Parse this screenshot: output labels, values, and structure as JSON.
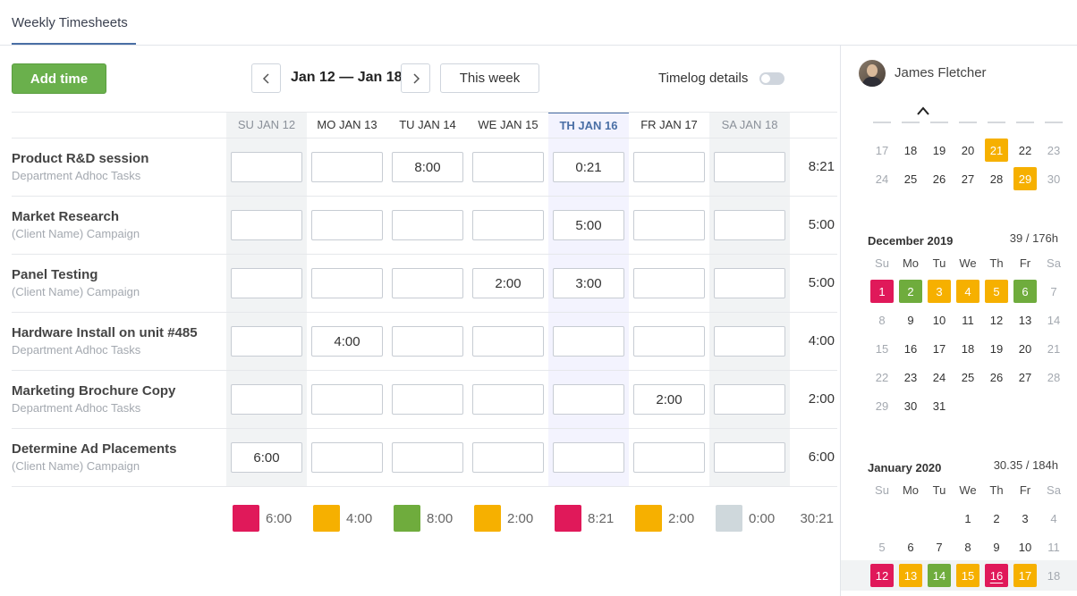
{
  "header": {
    "tab_title": "Weekly Timesheets"
  },
  "toolbar": {
    "add_time": "Add time",
    "date_range": "Jan 12 — Jan 18",
    "this_week": "This week",
    "timelog_details": "Timelog details"
  },
  "days": [
    {
      "label": "SU JAN 12",
      "kind": "weekend"
    },
    {
      "label": "MO JAN 13",
      "kind": "weekday"
    },
    {
      "label": "TU JAN 14",
      "kind": "weekday"
    },
    {
      "label": "WE JAN 15",
      "kind": "weekday"
    },
    {
      "label": "TH JAN 16",
      "kind": "today"
    },
    {
      "label": "FR JAN 17",
      "kind": "weekday"
    },
    {
      "label": "SA JAN 18",
      "kind": "weekend"
    }
  ],
  "rows": [
    {
      "title": "Product R&D session",
      "sub": "Department Adhoc Tasks",
      "cells": [
        "",
        "",
        "8:00",
        "",
        "0:21",
        "",
        ""
      ],
      "total": "8:21"
    },
    {
      "title": "Market Research",
      "sub": "(Client Name) Campaign",
      "cells": [
        "",
        "",
        "",
        "",
        "5:00",
        "",
        ""
      ],
      "total": "5:00"
    },
    {
      "title": "Panel Testing",
      "sub": "(Client Name) Campaign",
      "cells": [
        "",
        "",
        "",
        "2:00",
        "3:00",
        "",
        ""
      ],
      "total": "5:00"
    },
    {
      "title": "Hardware Install on unit #485",
      "sub": "Department Adhoc Tasks",
      "cells": [
        "",
        "4:00",
        "",
        "",
        "",
        "",
        ""
      ],
      "total": "4:00"
    },
    {
      "title": "Marketing Brochure Copy",
      "sub": "Department Adhoc Tasks",
      "cells": [
        "",
        "",
        "",
        "",
        "",
        "2:00",
        ""
      ],
      "total": "2:00"
    },
    {
      "title": "Determine Ad Placements",
      "sub": "(Client Name) Campaign",
      "cells": [
        "6:00",
        "",
        "",
        "",
        "",
        "",
        ""
      ],
      "total": "6:00"
    }
  ],
  "day_totals": [
    {
      "value": "6:00",
      "color": "#e0195a"
    },
    {
      "value": "4:00",
      "color": "#f6b000"
    },
    {
      "value": "8:00",
      "color": "#6fac3d"
    },
    {
      "value": "2:00",
      "color": "#f6b000"
    },
    {
      "value": "8:21",
      "color": "#e0195a"
    },
    {
      "value": "2:00",
      "color": "#f6b000"
    },
    {
      "value": "0:00",
      "color": "#cfd8dc"
    }
  ],
  "grand_total": "30:21",
  "user": {
    "name": "James Fletcher"
  },
  "calendar": {
    "dow": [
      "Su",
      "Mo",
      "Tu",
      "We",
      "Th",
      "Fr",
      "Sa"
    ],
    "prev_tail": [
      [
        {
          "d": "17"
        },
        {
          "d": "18"
        },
        {
          "d": "19"
        },
        {
          "d": "20"
        },
        {
          "d": "21",
          "c": "orange"
        },
        {
          "d": "22"
        },
        {
          "d": "23"
        }
      ],
      [
        {
          "d": "24"
        },
        {
          "d": "25"
        },
        {
          "d": "26"
        },
        {
          "d": "27"
        },
        {
          "d": "28"
        },
        {
          "d": "29",
          "c": "orange"
        },
        {
          "d": "30"
        }
      ]
    ],
    "months": [
      {
        "name": "December 2019",
        "hours": "39 / 176h",
        "weeks": [
          [
            {
              "d": "1",
              "c": "red"
            },
            {
              "d": "2",
              "c": "green"
            },
            {
              "d": "3",
              "c": "orange"
            },
            {
              "d": "4",
              "c": "orange"
            },
            {
              "d": "5",
              "c": "orange"
            },
            {
              "d": "6",
              "c": "green"
            },
            {
              "d": "7"
            }
          ],
          [
            {
              "d": "8"
            },
            {
              "d": "9"
            },
            {
              "d": "10"
            },
            {
              "d": "11"
            },
            {
              "d": "12"
            },
            {
              "d": "13"
            },
            {
              "d": "14"
            }
          ],
          [
            {
              "d": "15"
            },
            {
              "d": "16"
            },
            {
              "d": "17"
            },
            {
              "d": "18"
            },
            {
              "d": "19"
            },
            {
              "d": "20"
            },
            {
              "d": "21"
            }
          ],
          [
            {
              "d": "22"
            },
            {
              "d": "23"
            },
            {
              "d": "24"
            },
            {
              "d": "25"
            },
            {
              "d": "26"
            },
            {
              "d": "27"
            },
            {
              "d": "28"
            }
          ],
          [
            {
              "d": "29"
            },
            {
              "d": "30"
            },
            {
              "d": "31"
            },
            {
              "d": ""
            },
            {
              "d": ""
            },
            {
              "d": ""
            },
            {
              "d": ""
            }
          ]
        ]
      },
      {
        "name": "January 2020",
        "hours": "30.35 / 184h",
        "weeks": [
          [
            {
              "d": ""
            },
            {
              "d": ""
            },
            {
              "d": ""
            },
            {
              "d": "1"
            },
            {
              "d": "2"
            },
            {
              "d": "3"
            },
            {
              "d": "4"
            }
          ],
          [
            {
              "d": "5"
            },
            {
              "d": "6"
            },
            {
              "d": "7"
            },
            {
              "d": "8"
            },
            {
              "d": "9"
            },
            {
              "d": "10"
            },
            {
              "d": "11"
            }
          ],
          [
            {
              "d": "12",
              "c": "red"
            },
            {
              "d": "13",
              "c": "orange"
            },
            {
              "d": "14",
              "c": "green"
            },
            {
              "d": "15",
              "c": "orange"
            },
            {
              "d": "16",
              "c": "red",
              "today": true
            },
            {
              "d": "17",
              "c": "orange"
            },
            {
              "d": "18"
            }
          ]
        ]
      }
    ]
  }
}
